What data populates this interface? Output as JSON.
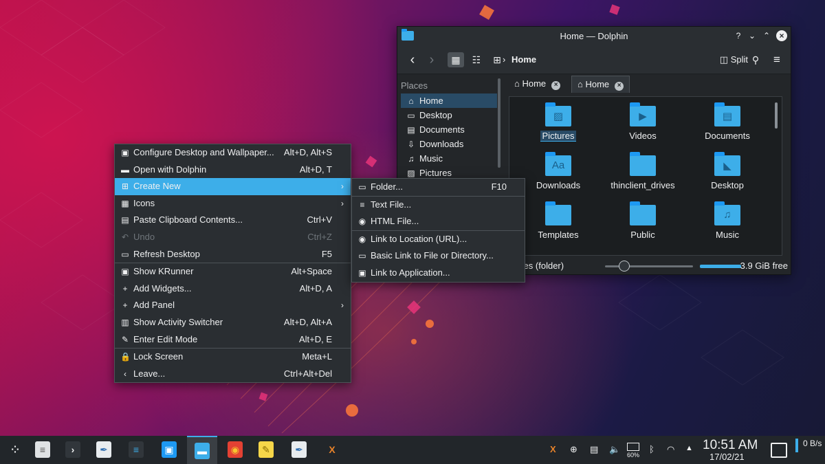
{
  "colors": {
    "accent": "#3daee9",
    "window_bg": "#232629",
    "menu_bg": "#2a2e32",
    "selection": "#294b66"
  },
  "dolphin": {
    "title": "Home — Dolphin",
    "help_icon": "?",
    "breadcrumb": "Home",
    "split_label": "Split",
    "places_header": "Places",
    "places": [
      {
        "label": "Home",
        "icon": "home-icon",
        "glyph": "⌂"
      },
      {
        "label": "Desktop",
        "icon": "desktop-icon",
        "glyph": "▭"
      },
      {
        "label": "Documents",
        "icon": "documents-icon",
        "glyph": "▤"
      },
      {
        "label": "Downloads",
        "icon": "downloads-icon",
        "glyph": "⇩"
      },
      {
        "label": "Music",
        "icon": "music-icon",
        "glyph": "♫"
      },
      {
        "label": "Pictures",
        "icon": "pictures-icon",
        "glyph": "▨"
      }
    ],
    "tabs": [
      {
        "label": "Home"
      },
      {
        "label": "Home"
      }
    ],
    "files": [
      {
        "label": "Pictures",
        "emblem": "▨"
      },
      {
        "label": "Videos",
        "emblem": "▶"
      },
      {
        "label": "Documents",
        "emblem": "▤"
      },
      {
        "label": "Downloads",
        "emblem": "Aa"
      },
      {
        "label": "thinclient_drives",
        "emblem": ""
      },
      {
        "label": "Desktop",
        "emblem": "◣"
      },
      {
        "label": "Templates",
        "emblem": ""
      },
      {
        "label": "Public",
        "emblem": ""
      },
      {
        "label": "Music",
        "emblem": "♫"
      }
    ],
    "status_text": "ures (folder)",
    "free_space": "3.9 GiB free"
  },
  "context_menu": {
    "items": [
      {
        "label": "Configure Desktop and Wallpaper...",
        "shortcut": "Alt+D, Alt+S",
        "glyph": "▣"
      },
      {
        "label": "Open with Dolphin",
        "shortcut": "Alt+D, T",
        "glyph": "▬"
      },
      {
        "label": "Create New",
        "shortcut": "",
        "glyph": "⊞"
      },
      {
        "label": "Icons",
        "shortcut": "",
        "glyph": "▦"
      },
      {
        "label": "Paste Clipboard Contents...",
        "shortcut": "Ctrl+V",
        "glyph": "▤"
      },
      {
        "label": "Undo",
        "shortcut": "Ctrl+Z",
        "glyph": "↶"
      },
      {
        "label": "Refresh Desktop",
        "shortcut": "F5",
        "glyph": "▭"
      },
      {
        "label": "Show KRunner",
        "shortcut": "Alt+Space",
        "glyph": "▣"
      },
      {
        "label": "Add Widgets...",
        "shortcut": "Alt+D, A",
        "glyph": "+"
      },
      {
        "label": "Add Panel",
        "shortcut": "",
        "glyph": "+"
      },
      {
        "label": "Show Activity Switcher",
        "shortcut": "Alt+D, Alt+A",
        "glyph": "▥"
      },
      {
        "label": "Enter Edit Mode",
        "shortcut": "Alt+D, E",
        "glyph": "✎"
      },
      {
        "label": "Lock Screen",
        "shortcut": "Meta+L",
        "glyph": "🔒"
      },
      {
        "label": "Leave...",
        "shortcut": "Ctrl+Alt+Del",
        "glyph": "‹"
      }
    ],
    "submenu": [
      {
        "label": "Folder...",
        "shortcut": "F10",
        "glyph": "▭"
      },
      {
        "label": "Text File...",
        "shortcut": "",
        "glyph": "≡"
      },
      {
        "label": "HTML File...",
        "shortcut": "",
        "glyph": "◉"
      },
      {
        "label": "Link to Location (URL)...",
        "shortcut": "",
        "glyph": "◉"
      },
      {
        "label": "Basic Link to File or Directory...",
        "shortcut": "",
        "glyph": "▭"
      },
      {
        "label": "Link to Application...",
        "shortcut": "",
        "glyph": "▣"
      }
    ]
  },
  "taskbar": {
    "clock_time": "10:51 AM",
    "clock_date": "17/02/21",
    "battery_label": "60%",
    "net_speed": "0 B/s",
    "tasks": [
      {
        "name": "launcher-icon"
      },
      {
        "name": "text-editor-icon"
      },
      {
        "name": "terminal-icon"
      },
      {
        "name": "kwrite-icon"
      },
      {
        "name": "system-settings-icon"
      },
      {
        "name": "discover-store-icon"
      },
      {
        "name": "dolphin-icon"
      },
      {
        "name": "chrome-icon"
      },
      {
        "name": "notes-icon"
      },
      {
        "name": "kwrite-2-icon"
      },
      {
        "name": "xed-icon"
      }
    ]
  }
}
